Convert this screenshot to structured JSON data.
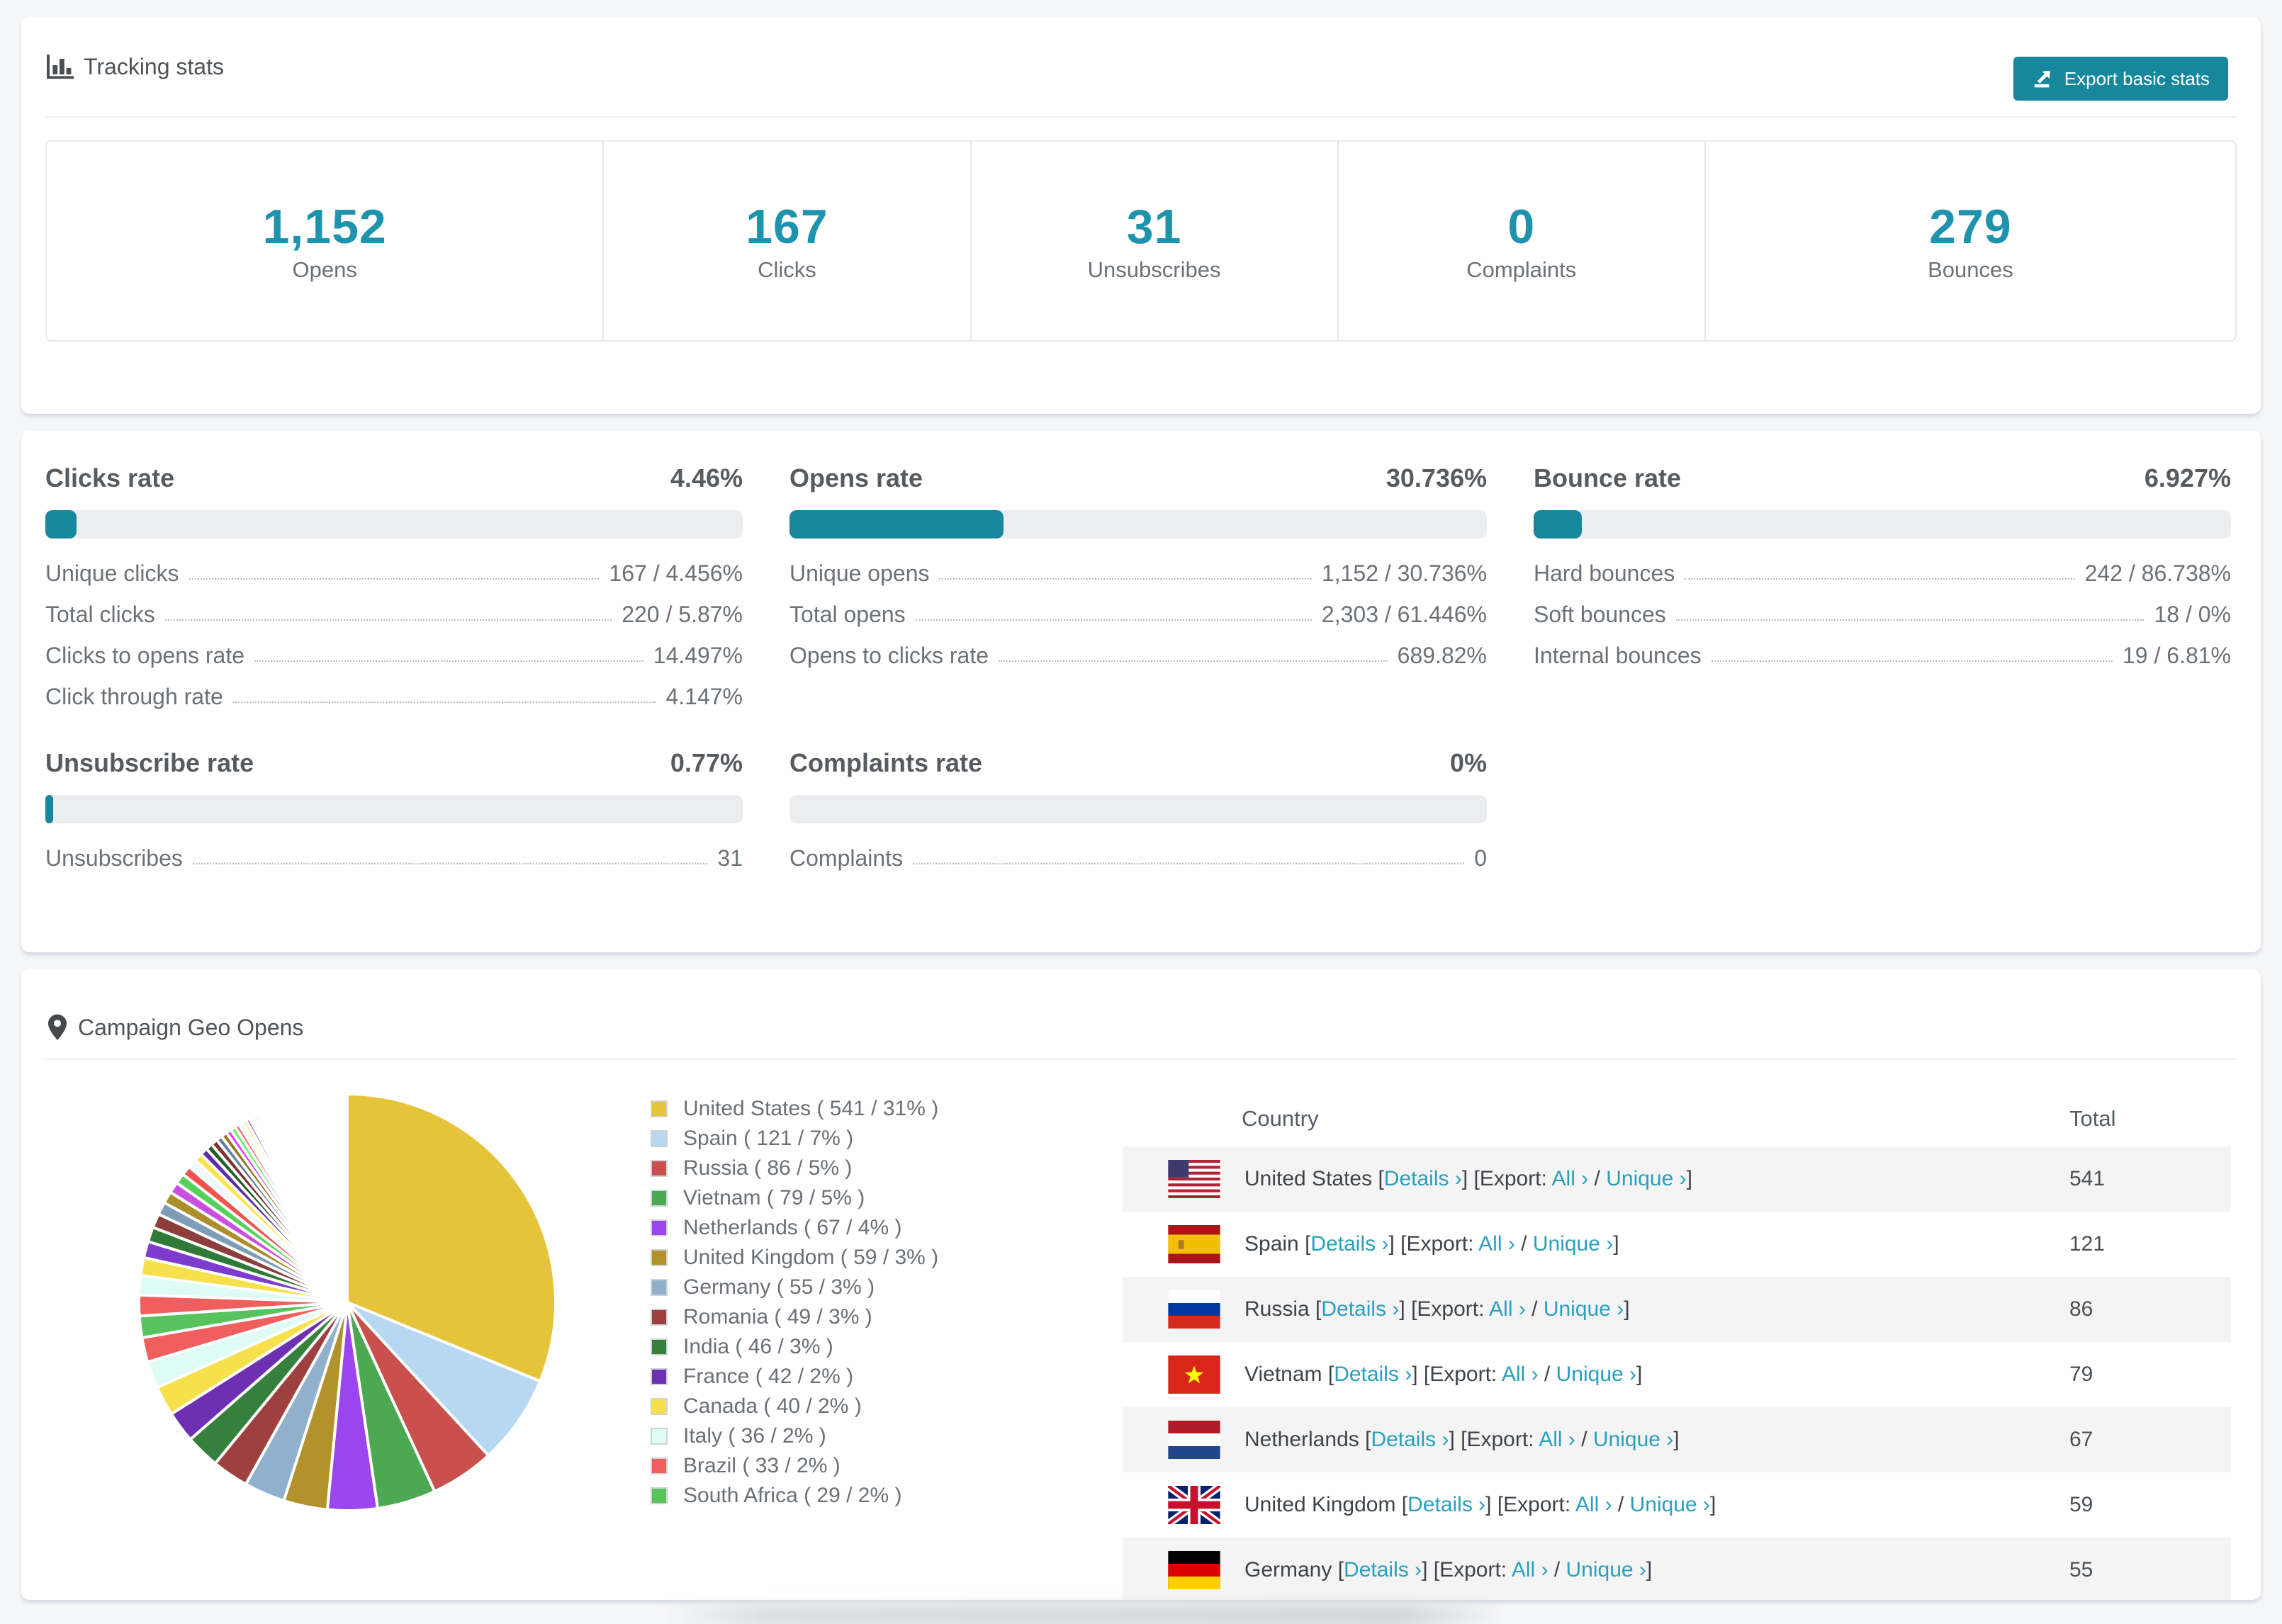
{
  "page": {
    "background": "#f5f6f8",
    "accent_teal": "#17879e",
    "number_teal": "#1d93ad",
    "link_teal": "#2b9fbd"
  },
  "tracking": {
    "title": "Tracking stats",
    "export_label": "Export basic stats",
    "summary": [
      {
        "value": "1,152",
        "label": "Opens"
      },
      {
        "value": "167",
        "label": "Clicks"
      },
      {
        "value": "31",
        "label": "Unsubscribes"
      },
      {
        "value": "0",
        "label": "Complaints"
      },
      {
        "value": "279",
        "label": "Bounces"
      }
    ]
  },
  "rates": {
    "panels": [
      {
        "id": "clicks-rate",
        "title": "Clicks rate",
        "value": "4.46%",
        "percent": 4.46,
        "rows": [
          {
            "label": "Unique clicks",
            "value": "167 / 4.456%"
          },
          {
            "label": "Total clicks",
            "value": "220 / 5.87%"
          },
          {
            "label": "Clicks to opens rate",
            "value": "14.497%"
          },
          {
            "label": "Click through rate",
            "value": "4.147%"
          }
        ]
      },
      {
        "id": "opens-rate",
        "title": "Opens rate",
        "value": "30.736%",
        "percent": 30.736,
        "rows": [
          {
            "label": "Unique opens",
            "value": "1,152 / 30.736%"
          },
          {
            "label": "Total opens",
            "value": "2,303 / 61.446%"
          },
          {
            "label": "Opens to clicks rate",
            "value": "689.82%"
          }
        ]
      },
      {
        "id": "bounce-rate",
        "title": "Bounce rate",
        "value": "6.927%",
        "percent": 6.927,
        "rows": [
          {
            "label": "Hard bounces",
            "value": "242 / 86.738%"
          },
          {
            "label": "Soft bounces",
            "value": "18 / 0%"
          },
          {
            "label": "Internal bounces",
            "value": "19 / 6.81%"
          }
        ]
      },
      {
        "id": "unsubscribe-rate",
        "title": "Unsubscribe rate",
        "value": "0.77%",
        "percent": 0.77,
        "rows": [
          {
            "label": "Unsubscribes",
            "value": "31"
          }
        ]
      },
      {
        "id": "complaints-rate",
        "title": "Complaints rate",
        "value": "0%",
        "percent": 0,
        "rows": [
          {
            "label": "Complaints",
            "value": "0"
          }
        ]
      }
    ]
  },
  "geo": {
    "title": "Campaign Geo Opens",
    "chart_data": {
      "type": "pie",
      "title": "Campaign Geo Opens",
      "legend_position": "right",
      "categories": [
        "United States",
        "Spain",
        "Russia",
        "Vietnam",
        "Netherlands",
        "United Kingdom",
        "Germany",
        "Romania",
        "India",
        "France",
        "Canada",
        "Italy",
        "Brazil",
        "South Africa"
      ],
      "values": [
        541,
        121,
        86,
        79,
        67,
        59,
        55,
        49,
        46,
        42,
        40,
        36,
        33,
        29
      ],
      "percent_labels": [
        "31%",
        "7%",
        "5%",
        "5%",
        "4%",
        "3%",
        "3%",
        "3%",
        "3%",
        "2%",
        "2%",
        "2%",
        "2%",
        "2%"
      ],
      "colors": [
        "#e5c43c",
        "#b8d8f2",
        "#c9504c",
        "#4ca852",
        "#9b45ee",
        "#b3912b",
        "#90b0cc",
        "#9e4040",
        "#35803c",
        "#6e30b2",
        "#f6e04c",
        "#dffbf5",
        "#f05f5e",
        "#58c35d"
      ],
      "others_values": [
        28,
        26,
        24,
        22,
        20,
        19,
        17,
        16,
        15,
        14,
        13,
        12,
        11,
        10,
        9,
        9,
        8,
        8,
        7,
        7,
        6,
        6,
        5,
        5,
        4,
        4,
        4,
        3,
        3,
        3,
        2,
        2,
        2,
        2,
        1,
        1,
        1,
        1,
        1,
        1,
        1,
        1,
        1,
        1,
        1,
        1,
        1,
        1,
        1,
        1
      ],
      "tail_colors": [
        "#f05f5e",
        "#dffbf5",
        "#f6e04c",
        "#7e3bd0",
        "#2f7a36",
        "#8e3d3d",
        "#7d9cb8",
        "#a98e2a",
        "#c94fe0",
        "#55d05a",
        "#ef5350",
        "#eef9ff",
        "#ffe34d",
        "#5a2ea6",
        "#245c2a",
        "#7a3333",
        "#5d7d99",
        "#8f7a20",
        "#e040fb",
        "#69f06e"
      ],
      "unaccounted": 90
    },
    "legend_format": {
      "open": "( ",
      "sep": " / ",
      "close": " )"
    },
    "table": {
      "headers": [
        "Country",
        "Total"
      ],
      "details_label": "Details ›",
      "export_prefix": "[Export: ",
      "all_label": "All ›",
      "unique_label": "Unique ›",
      "rows": [
        {
          "country": "United States",
          "flag": "us",
          "total": "541"
        },
        {
          "country": "Spain",
          "flag": "es",
          "total": "121"
        },
        {
          "country": "Russia",
          "flag": "ru",
          "total": "86"
        },
        {
          "country": "Vietnam",
          "flag": "vn",
          "total": "79"
        },
        {
          "country": "Netherlands",
          "flag": "nl",
          "total": "67"
        },
        {
          "country": "United Kingdom",
          "flag": "gb",
          "total": "59"
        },
        {
          "country": "Germany",
          "flag": "de",
          "total": "55"
        }
      ]
    }
  }
}
